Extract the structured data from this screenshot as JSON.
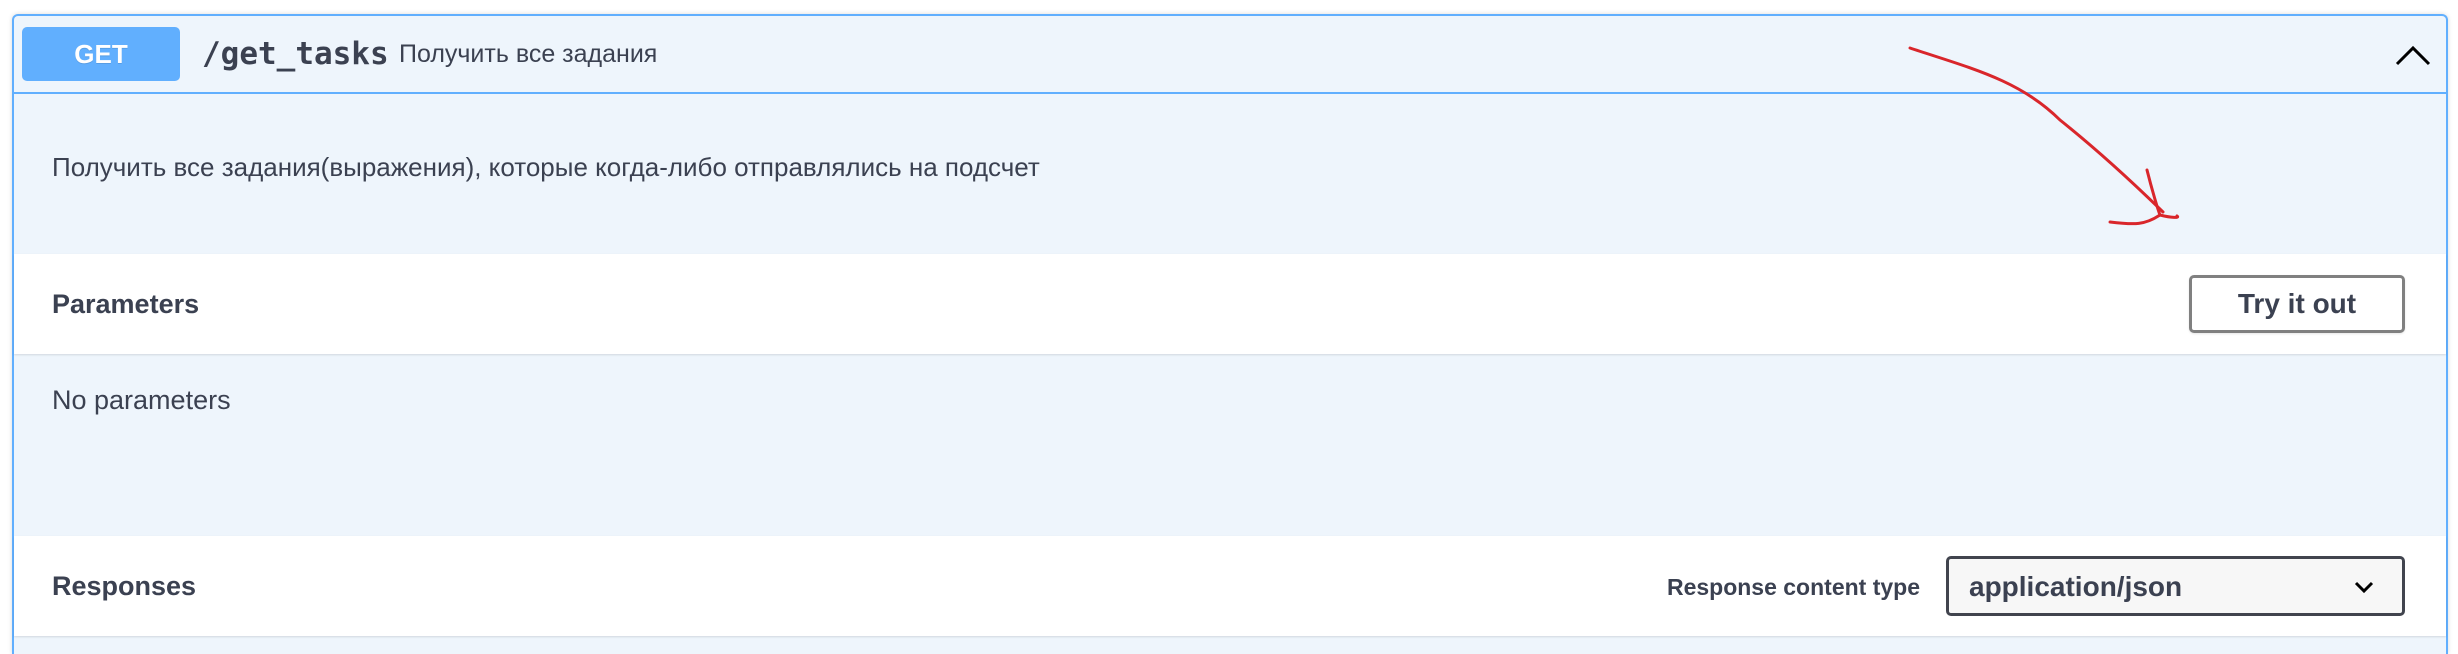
{
  "operation": {
    "method": "GET",
    "path": "/get_tasks",
    "summary": "Получить все задания",
    "description": "Получить все задания(выражения), которые когда-либо отправлялись на подсчет"
  },
  "parameters": {
    "title": "Parameters",
    "try_button": "Try it out",
    "empty_text": "No parameters"
  },
  "responses": {
    "title": "Responses",
    "content_type_label": "Response content type",
    "content_type_value": "application/json"
  },
  "icons": {
    "collapse": "chevron-up-icon",
    "dropdown": "chevron-down-icon",
    "annotation": "red-arrow-annotation"
  },
  "colors": {
    "method_get": "#61affe",
    "block_bg": "#eef5fc",
    "annotation": "#d9262b"
  }
}
